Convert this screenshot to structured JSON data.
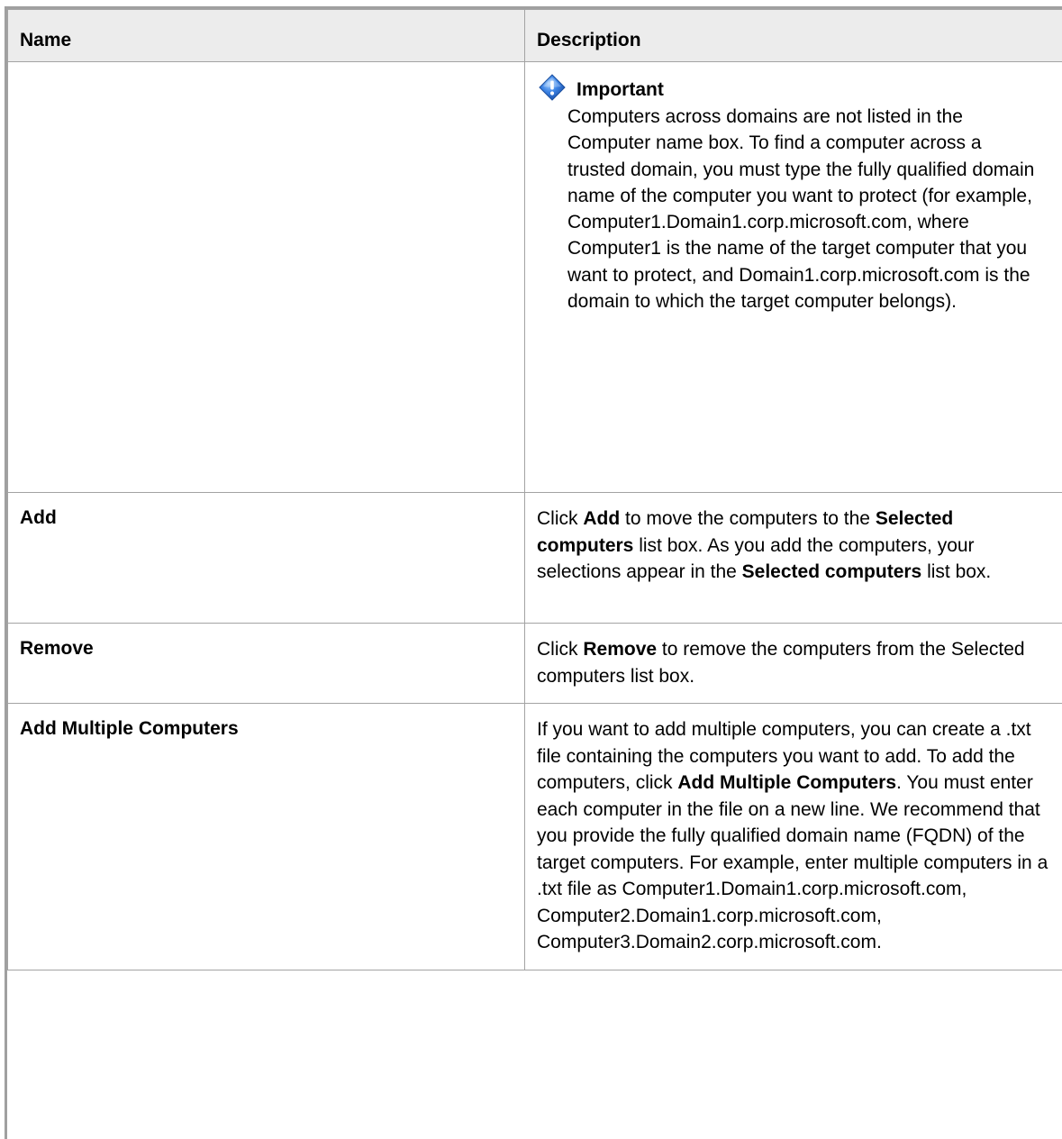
{
  "table": {
    "headers": {
      "name": "Name",
      "description": "Description"
    },
    "important_row": {
      "name": "",
      "label": "Important",
      "text": "Computers across domains are not listed in the Computer name box. To find a computer across a trusted domain, you must type the fully qualified domain name of the computer you want to protect (for example, Computer1.Domain1.corp.microsoft.com, where Computer1 is the name of the target computer that you want to protect, and Domain1.corp.microsoft.com is the domain to which the target computer belongs)."
    },
    "rows": [
      {
        "name": "Add",
        "description": {
          "p1": "Click ",
          "b1": "Add",
          "p2": " to move the computers to the ",
          "b2": "Selected computers",
          "p3": " list box. As you add the computers, your selections appear in the ",
          "b3": "Selected computers",
          "p4": " list box."
        }
      },
      {
        "name": "Remove",
        "description": {
          "p1": "Click ",
          "b1": "Remove",
          "p2": " to remove the computers from the Selected computers list box."
        }
      },
      {
        "name": "Add Multiple Computers",
        "description": {
          "p1": "If you want to add multiple computers, you can create a .txt file containing the computers you want to add. To add the computers, click ",
          "b1": "Add Multiple Computers",
          "p2": ". You must enter each computer in the file on a new line. We recommend that you provide the fully qualified domain name (FQDN) of the target computers. For example, enter multiple computers in a .txt file as Computer1.Domain1.corp.microsoft.com, Computer2.Domain1.corp.microsoft.com, Computer3.Domain2.corp.microsoft.com."
        }
      }
    ]
  },
  "icons": {
    "important": "important-info-icon"
  },
  "colors": {
    "header_background": "#ececec",
    "border": "#a3a3a3",
    "icon_blue": "#2f6fd6"
  }
}
